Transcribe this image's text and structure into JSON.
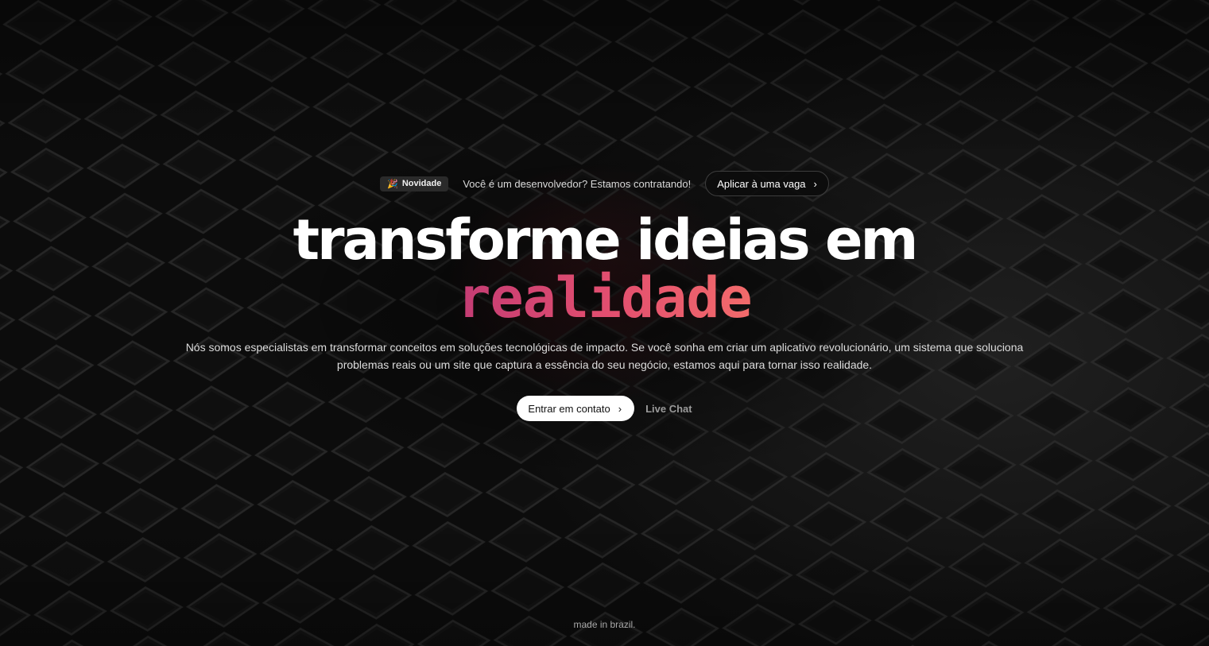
{
  "announcement": {
    "badge_icon": "party-popper-icon",
    "badge_label": "Novidade",
    "text": "Você é um desenvolvedor? Estamos contratando!",
    "cta_label": "Aplicar à uma vaga"
  },
  "hero": {
    "title_line1": "transforme ideias em",
    "title_line2": "realidade",
    "description": "Nós somos especialistas em transformar conceitos em soluções tecnológicas de impacto. Se você sonha em criar um aplicativo revolucionário, um sistema que soluciona problemas reais ou um site que captura a essência do seu negócio, estamos aqui para tornar isso realidade.",
    "primary_cta": "Entrar em contato",
    "secondary_cta": "Live Chat"
  },
  "footer": {
    "text": "made in brazil."
  },
  "colors": {
    "background": "#0c0c0c",
    "accent_start": "#c43c74",
    "accent_end": "#f26b6b"
  }
}
